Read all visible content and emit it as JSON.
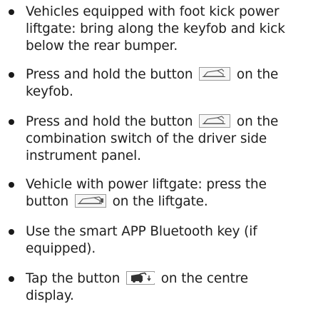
{
  "items": [
    {
      "lines": [
        "Vehicles equipped with foot kick power",
        "liftgate: bring along the keyfob and kick",
        "below the rear bumper."
      ]
    },
    {
      "line1_before": "Press and hold the button",
      "line1_after": "on the",
      "line2": "keyfob.",
      "icon": "liftgate-icon"
    },
    {
      "line1_before": "Press and hold the button",
      "line1_after": "on the",
      "line2": "combination switch of the driver side",
      "line3": "instrument panel.",
      "icon": "liftgate-icon"
    },
    {
      "line1": "Vehicle with power liftgate: press the",
      "line2_before": "button",
      "line2_after": "on the liftgate.",
      "icon": "liftgate-switch-icon"
    },
    {
      "line1": "Use the smart APP Bluetooth key (if",
      "line2": "equipped)."
    },
    {
      "line1_before": "Tap the button",
      "line1_after": "on the centre",
      "line2": "display.",
      "icon": "tailgate-open-display-icon"
    }
  ]
}
